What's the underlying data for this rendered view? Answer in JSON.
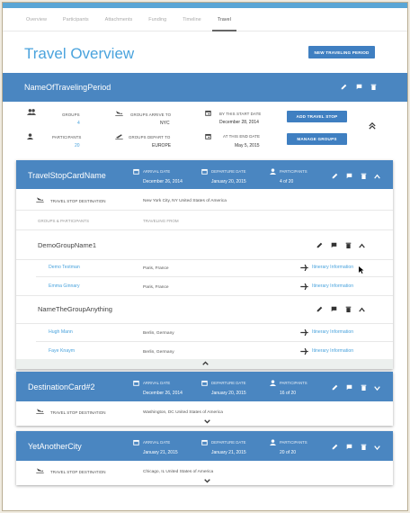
{
  "tabs": [
    "Overview",
    "Participants",
    "Attachments",
    "Funding",
    "Timeline",
    "Travel"
  ],
  "page_title": "Travel Overview",
  "new_period_label": "NEW TRAVELING PERIOD",
  "period": {
    "name": "NameOfTravelingPeriod",
    "groups_label": "GROUPS",
    "groups_value": "4",
    "participants_label": "PARTICIPANTS",
    "participants_value": "20",
    "arrive_label": "GROUPS ARRIVE TO",
    "arrive_value": "NYC",
    "depart_label": "GROUPS DEPART TO",
    "depart_value": "EUROPE",
    "start_label": "BY THIS START DATE",
    "start_value": "December 28, 2014",
    "end_label": "AT THIS END DATE",
    "end_value": "May 5, 2015",
    "add_stop_label": "ADD TRAVEL STOP",
    "manage_groups_label": "MANAGE GROUPS"
  },
  "card1": {
    "name": "TravelStopCardName",
    "arrival_label": "ARRIVAL DATE",
    "arrival_value": "December 26, 2014",
    "departure_label": "DEPARTURE DATE",
    "departure_value": "January 20, 2015",
    "participants_label": "PARTICIPANTS",
    "participants_value": "4 of 20",
    "dest_label": "TRAVEL STOP DESTINATION",
    "dest_value": "New York City, NY United States of America",
    "groups_header": "GROUPS & PARTICIPANTS",
    "from_header": "TRAVELING FROM",
    "group1": "DemoGroupName1",
    "g1_people": [
      {
        "name": "Demo Testman",
        "from": "Paris, France",
        "link": "Itinerary Information"
      },
      {
        "name": "Emma Ginnary",
        "from": "Paris, France",
        "link": "Itinerary Information"
      }
    ],
    "group2": "NameTheGroupAnything",
    "g2_people": [
      {
        "name": "Hugh Mann",
        "from": "Berlin, Germany",
        "link": "Itinerary Information"
      },
      {
        "name": "Faye Knaym",
        "from": "Berlin, Germany",
        "link": "Itinerary Information"
      }
    ]
  },
  "card2": {
    "name": "DestinationCard#2",
    "arrival_label": "ARRIVAL DATE",
    "arrival_value": "December 26, 2014",
    "departure_label": "DEPARTURE DATE",
    "departure_value": "January 20, 2015",
    "participants_label": "PARTICIPANTS",
    "participants_value": "16 of 20",
    "dest_label": "TRAVEL STOP DESTINATION",
    "dest_value": "Washington, DC United States of America"
  },
  "card3": {
    "name": "YetAnotherCity",
    "arrival_label": "ARRIVAL DATE",
    "arrival_value": "January 21, 2015",
    "departure_label": "DEPARTURE DATE",
    "departure_value": "January 21, 2015",
    "participants_label": "PARTICIPANTS",
    "participants_value": "20 of 20",
    "dest_label": "TRAVEL STOP DESTINATION",
    "dest_value": "Chicago, IL United States of America"
  }
}
